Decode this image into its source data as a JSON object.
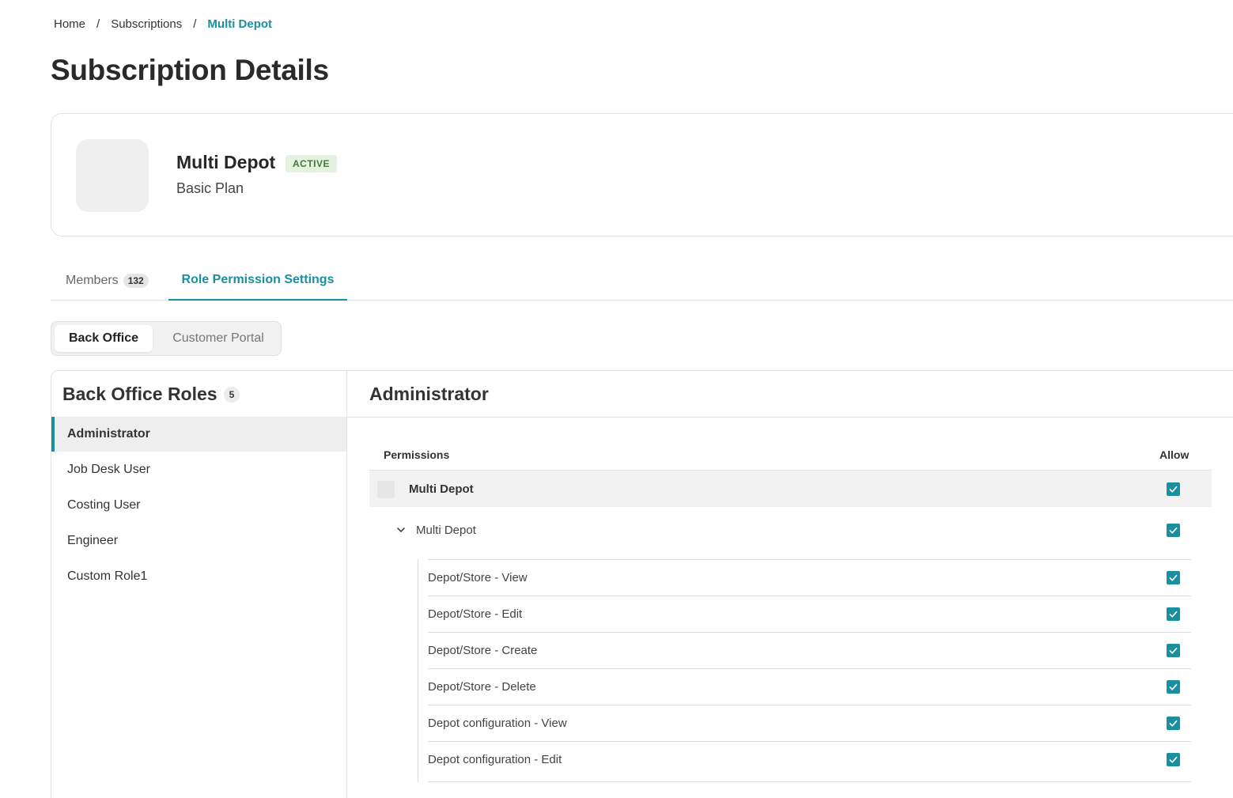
{
  "breadcrumb": {
    "home": "Home",
    "subscriptions": "Subscriptions",
    "current": "Multi Depot",
    "separator": "/"
  },
  "page_title": "Subscription Details",
  "subscription": {
    "name": "Multi Depot",
    "status": "ACTIVE",
    "plan": "Basic Plan"
  },
  "tabs": {
    "members_label": "Members",
    "members_count": "132",
    "roles_label": "Role Permission Settings"
  },
  "segment": {
    "back_office": "Back Office",
    "customer_portal": "Customer Portal"
  },
  "roles": {
    "title": "Back Office Roles",
    "count": "5",
    "items": [
      {
        "label": "Administrator"
      },
      {
        "label": "Job Desk User"
      },
      {
        "label": "Costing User"
      },
      {
        "label": "Engineer"
      },
      {
        "label": "Custom Role1"
      }
    ]
  },
  "detail": {
    "title": "Administrator",
    "col_permissions": "Permissions",
    "col_allow": "Allow",
    "group_label": "Multi Depot",
    "sub_group_label": "Multi Depot",
    "permissions": [
      {
        "label": "Depot/Store - View"
      },
      {
        "label": "Depot/Store - Edit"
      },
      {
        "label": "Depot/Store - Create"
      },
      {
        "label": "Depot/Store - Delete"
      },
      {
        "label": "Depot configuration - View"
      },
      {
        "label": "Depot configuration - Edit"
      }
    ]
  },
  "colors": {
    "accent": "#1a8fa0",
    "badge_bg": "#e5f2df",
    "badge_text": "#3f7a3a"
  }
}
